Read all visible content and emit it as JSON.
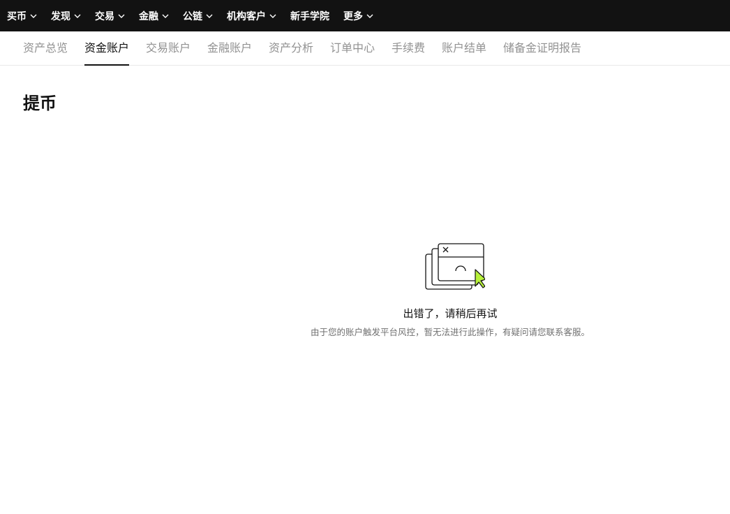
{
  "topnav": {
    "items": [
      {
        "label": "买币",
        "has_dropdown": true
      },
      {
        "label": "发现",
        "has_dropdown": true
      },
      {
        "label": "交易",
        "has_dropdown": true
      },
      {
        "label": "金融",
        "has_dropdown": true
      },
      {
        "label": "公链",
        "has_dropdown": true
      },
      {
        "label": "机构客户",
        "has_dropdown": true
      },
      {
        "label": "新手学院",
        "has_dropdown": false
      },
      {
        "label": "更多",
        "has_dropdown": true
      }
    ]
  },
  "subnav": {
    "active_index": 1,
    "tabs": [
      {
        "label": "资产总览"
      },
      {
        "label": "资金账户"
      },
      {
        "label": "交易账户"
      },
      {
        "label": "金融账户"
      },
      {
        "label": "资产分析"
      },
      {
        "label": "订单中心"
      },
      {
        "label": "手续费"
      },
      {
        "label": "账户结单"
      },
      {
        "label": "储备金证明报告"
      }
    ]
  },
  "page": {
    "title": "提币"
  },
  "error_state": {
    "icon": "error-window-icon",
    "title": "出错了，请稍后再试",
    "description": "由于您的账户触发平台风控，暂无法进行此操作，有疑问请您联系客服。"
  },
  "colors": {
    "topbar_bg": "#121212",
    "accent_green": "#b7f13a",
    "inactive_tab": "#929292",
    "text_primary": "#121212",
    "text_secondary": "#707070"
  }
}
